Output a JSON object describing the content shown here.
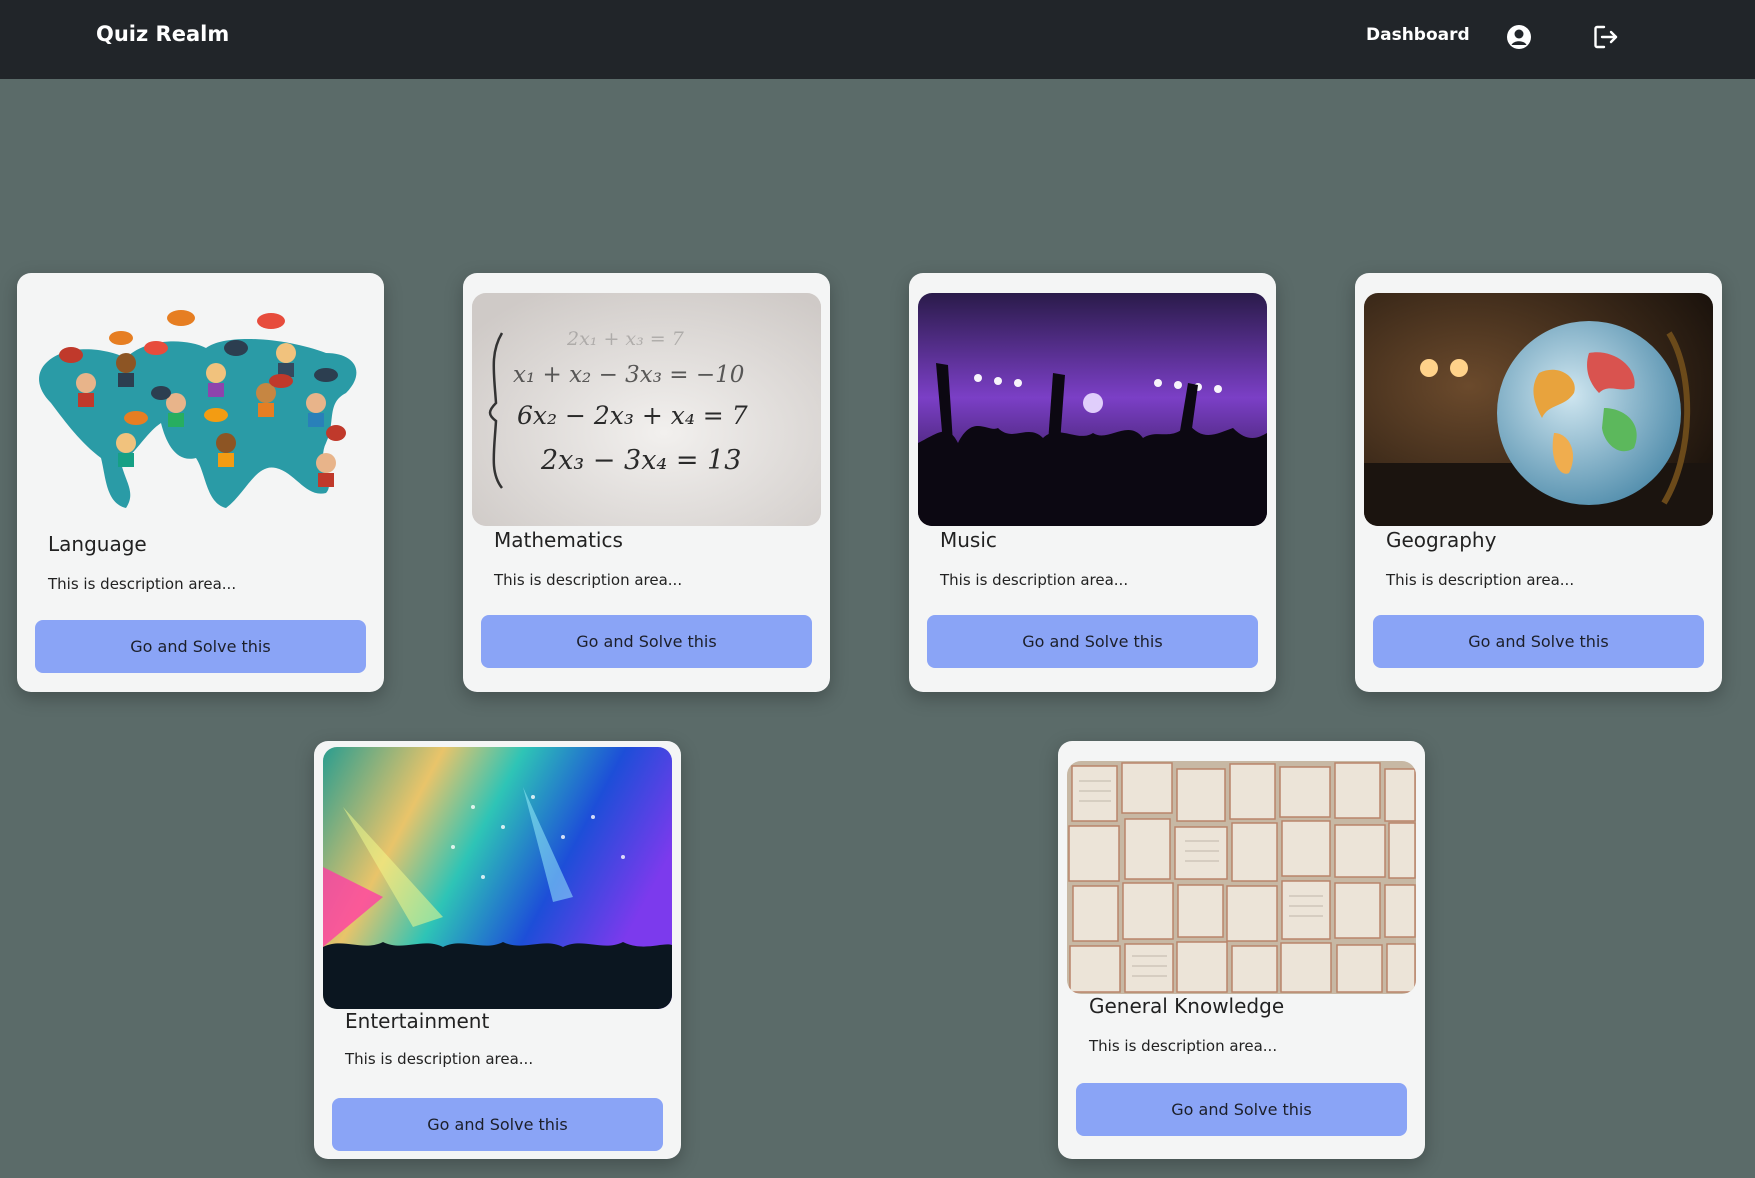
{
  "navbar": {
    "brand": "Quiz Realm",
    "dashboard_label": "Dashboard",
    "user_icon": "user-circle-icon",
    "logout_icon": "logout-icon"
  },
  "cards": [
    {
      "title": "Language",
      "description": "This is description area...",
      "button_label": "Go and Solve this",
      "image": "world-map-speech-bubbles"
    },
    {
      "title": "Mathematics",
      "description": "This is description area...",
      "button_label": "Go and Solve this",
      "image": "equation-system",
      "equations": [
        "2x₁ + x₃ = 7",
        "x₁ + x₂ − 3x₃ = −10",
        "6x₂ − 2x₃ + x₄ = 7",
        "2x₃ − 3x₄ = 13"
      ]
    },
    {
      "title": "Music",
      "description": "This is description area...",
      "button_label": "Go and Solve this",
      "image": "concert-crowd"
    },
    {
      "title": "Geography",
      "description": "This is description area...",
      "button_label": "Go and Solve this",
      "image": "globe"
    },
    {
      "title": "Entertainment",
      "description": "This is description area...",
      "button_label": "Go and Solve this",
      "image": "festival-lights"
    },
    {
      "title": "General Knowledge",
      "description": "This is description area...",
      "button_label": "Go and Solve this",
      "image": "open-books"
    }
  ],
  "colors": {
    "background": "#5b6b69",
    "navbar": "#212529",
    "card": "#f4f5f5",
    "button": "#8aa4f6"
  }
}
